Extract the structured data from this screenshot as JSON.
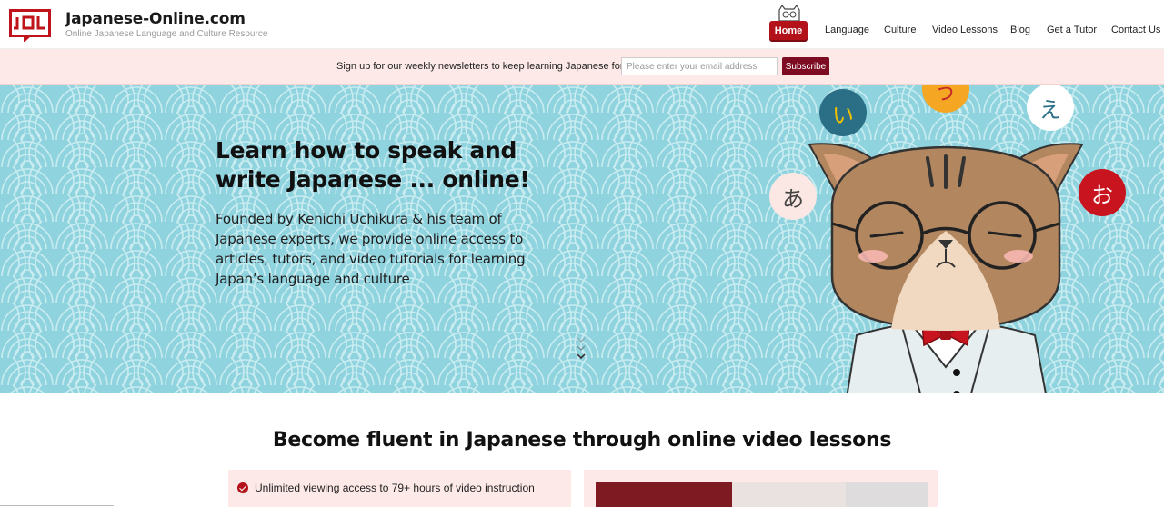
{
  "brand": {
    "title": "Japanese-Online.com",
    "subtitle": "Online Japanese Language and Culture Resource",
    "logo_text": "JOL"
  },
  "nav": {
    "home": "Home",
    "items": [
      "Language",
      "Culture",
      "Video Lessons",
      "Blog",
      "Get a Tutor",
      "Contact Us"
    ]
  },
  "newsletter": {
    "text": "Sign up for our weekly newsletters to keep learning Japanese for free!",
    "placeholder": "Please enter your email address",
    "button": "Subscribe"
  },
  "hero": {
    "title": "Learn how to speak and write Japanese ... online!",
    "description": "Founded by Kenichi Uchikura & his team of Japanese experts, we provide online access to articles, tutors, and video tutorials for learning Japan’s language and culture",
    "kana": [
      "あ",
      "い",
      "う",
      "え",
      "お"
    ]
  },
  "section": {
    "title": "Become fluent in Japanese through online video lessons",
    "feature": "Unlimited viewing access to 79+ hours of video instruction"
  },
  "colors": {
    "brand_red": "#b3121b",
    "hero_bg": "#8fd3de",
    "newsletter_bg": "#fde9e7",
    "subscribe_bg": "#7d0c22"
  }
}
